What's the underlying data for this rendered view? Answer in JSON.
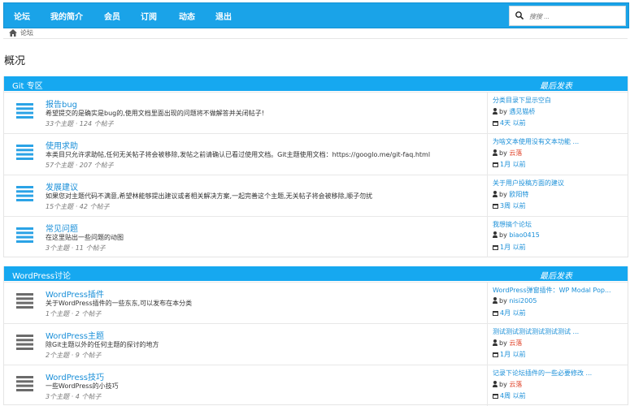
{
  "nav": {
    "items": [
      "论坛",
      "我的简介",
      "会员",
      "订阅",
      "动态",
      "退出"
    ],
    "search_placeholder": "搜搜 ..."
  },
  "breadcrumb": {
    "label": "论坛"
  },
  "page_title": "概况",
  "sections": [
    {
      "title": "Git 专区",
      "last_post_label": "最后发表",
      "forums": [
        {
          "title": "报告bug",
          "desc": "希望提交的是确实是bug的,使用文档里面出现的问题将不做解答并关闭帖子!",
          "meta": "33个主题 · 124 个帖子",
          "last_title": "分类目录下显示空白",
          "by_label": "by",
          "last_user": "遇见猫桥",
          "last_time": "4天 以前"
        },
        {
          "title": "使用求助",
          "desc": "本类目只允许求助帖,任何无关帖子将会被移除,发帖之前请确认已看过使用文档。Git主题使用文档：https://googlo.me/git-faq.html",
          "meta": "57个主题 · 207 个帖子",
          "last_title": "为啥文本使用没有文本功能 ...",
          "by_label": "by",
          "last_user": "云落",
          "last_time": "1月 以前"
        },
        {
          "title": "发展建议",
          "desc": "如果您对主题代码不满意,希望林能够提出建议或者相关解决方案,一起完善这个主题,无关帖子将会被移除,顺子勿扰",
          "meta": "15个主题 · 42 个帖子",
          "last_title": "关于用户投稿方面的建议",
          "by_label": "by",
          "last_user": "欧阳特",
          "last_time": "3周 以前"
        },
        {
          "title": "常见问题",
          "desc": "在这里贴出一些问题的动图",
          "meta": "3个主题 · 11 个帖子",
          "last_title": "我想搞个论坛",
          "by_label": "by",
          "last_user": "biao0415",
          "last_time": "1月 以前"
        }
      ]
    },
    {
      "title": "WordPress讨论",
      "last_post_label": "最后发表",
      "forums": [
        {
          "title": "WordPress插件",
          "desc": "关于WordPress插件的一些东东,可以发布在本分类",
          "meta": "1个主题 · 2 个帖子",
          "last_title": "WordPress弹窗插件：WP Modal Pop...",
          "by_label": "by",
          "last_user": "nisi2005",
          "last_time": "4月 以前"
        },
        {
          "title": "WordPress主题",
          "desc": "除Git主题以外的任何主题的探讨的地方",
          "meta": "2个主题 · 9 个帖子",
          "last_title": "测试测试测试测试测试测试 ...",
          "by_label": "by",
          "last_user": "云落",
          "last_time": "1月 以前"
        },
        {
          "title": "WordPress技巧",
          "desc": "一些WordPress的小技巧",
          "meta": "3个主题 · 4 个帖子",
          "last_title": "记录下论坛插件的一些必要修改 ...",
          "by_label": "by",
          "last_user": "云落",
          "last_time": "4周 以前"
        }
      ]
    }
  ],
  "colors": {
    "accent": "#1aa3e8",
    "link": "#1a8fd8",
    "icon_blue": "#2ba3e6",
    "icon_gray": "#6b6b6b",
    "red_user": "#e0452c"
  },
  "icons": [
    "search-icon",
    "home-icon",
    "forum-list-icon",
    "user-icon",
    "calendar-icon"
  ]
}
